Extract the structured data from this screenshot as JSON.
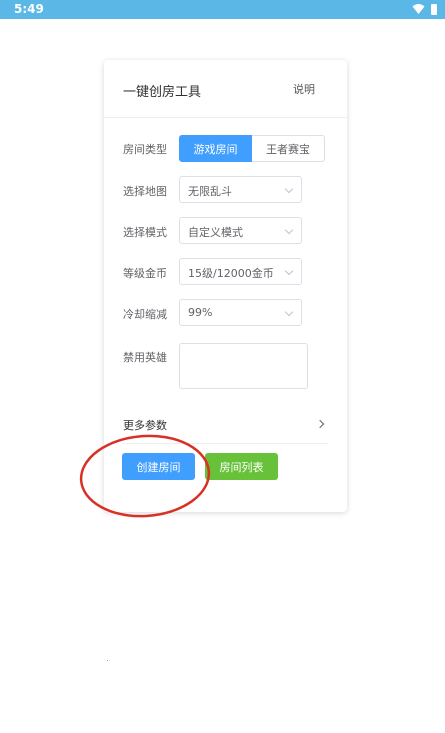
{
  "status_bar": {
    "time": "5:49",
    "icons": [
      "wifi-icon",
      "battery-icon"
    ]
  },
  "card": {
    "title": "一键创房工具",
    "help_link": "说明",
    "room_type": {
      "label": "房间类型",
      "options": [
        "游戏房间",
        "王者赛宝"
      ],
      "selected": "游戏房间"
    },
    "map": {
      "label": "选择地图",
      "value": "无限乱斗"
    },
    "mode": {
      "label": "选择模式",
      "value": "自定义模式"
    },
    "level_gold": {
      "label": "等级金币",
      "value": "15级/12000金币"
    },
    "cooldown": {
      "label": "冷却缩减",
      "value": "99%"
    },
    "banned_heroes": {
      "label": "禁用英雄",
      "value": ""
    },
    "more_params": "更多参数",
    "buttons": {
      "create_room": "创建房间",
      "room_list": "房间列表"
    }
  },
  "colors": {
    "status_bar": "#5bb8e6",
    "primary": "#409eff",
    "success": "#67c23a",
    "annotation": "#d93025"
  }
}
